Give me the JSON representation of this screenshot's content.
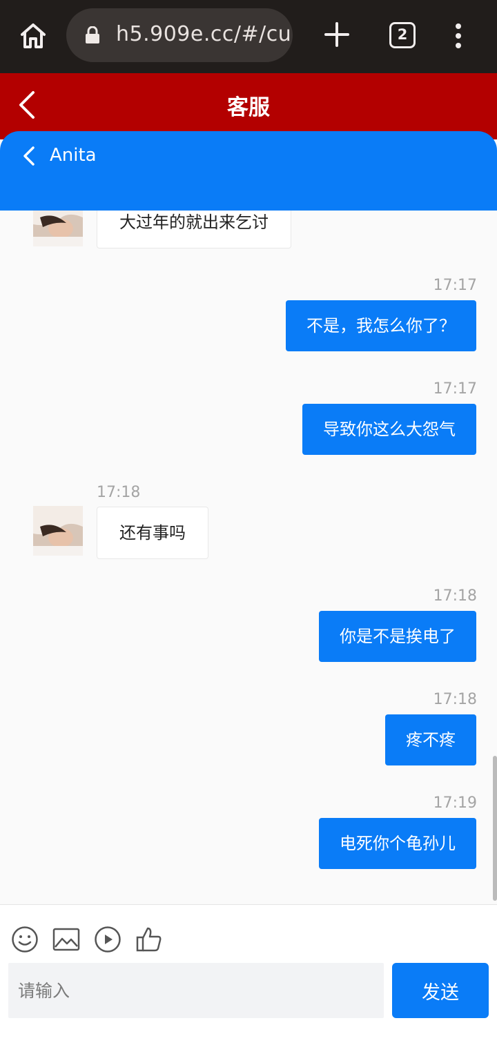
{
  "browser": {
    "url": "h5.909e.cc/#/cu",
    "tab_count": "2"
  },
  "header": {
    "title": "客服"
  },
  "chat": {
    "agent_name": "Anita"
  },
  "messages": [
    {
      "side": "left",
      "time": "",
      "text": "大过年的就出来乞讨"
    },
    {
      "side": "right",
      "time": "17:17",
      "text": "不是，我怎么你了？"
    },
    {
      "side": "right",
      "time": "17:17",
      "text": "导致你这么大怨气"
    },
    {
      "side": "left",
      "time": "17:18",
      "text": "还有事吗"
    },
    {
      "side": "right",
      "time": "17:18",
      "text": "你是不是挨电了"
    },
    {
      "side": "right",
      "time": "17:18",
      "text": "疼不疼"
    },
    {
      "side": "right",
      "time": "17:19",
      "text": "电死你个龟孙儿"
    }
  ],
  "composer": {
    "placeholder": "请输入",
    "send_label": "发送",
    "tools": [
      "emoji-icon",
      "image-icon",
      "video-icon",
      "thumbs-up-icon"
    ]
  },
  "colors": {
    "browser_bg": "#211d1b",
    "header_red": "#b30000",
    "accent_blue": "#0a7cf7"
  }
}
